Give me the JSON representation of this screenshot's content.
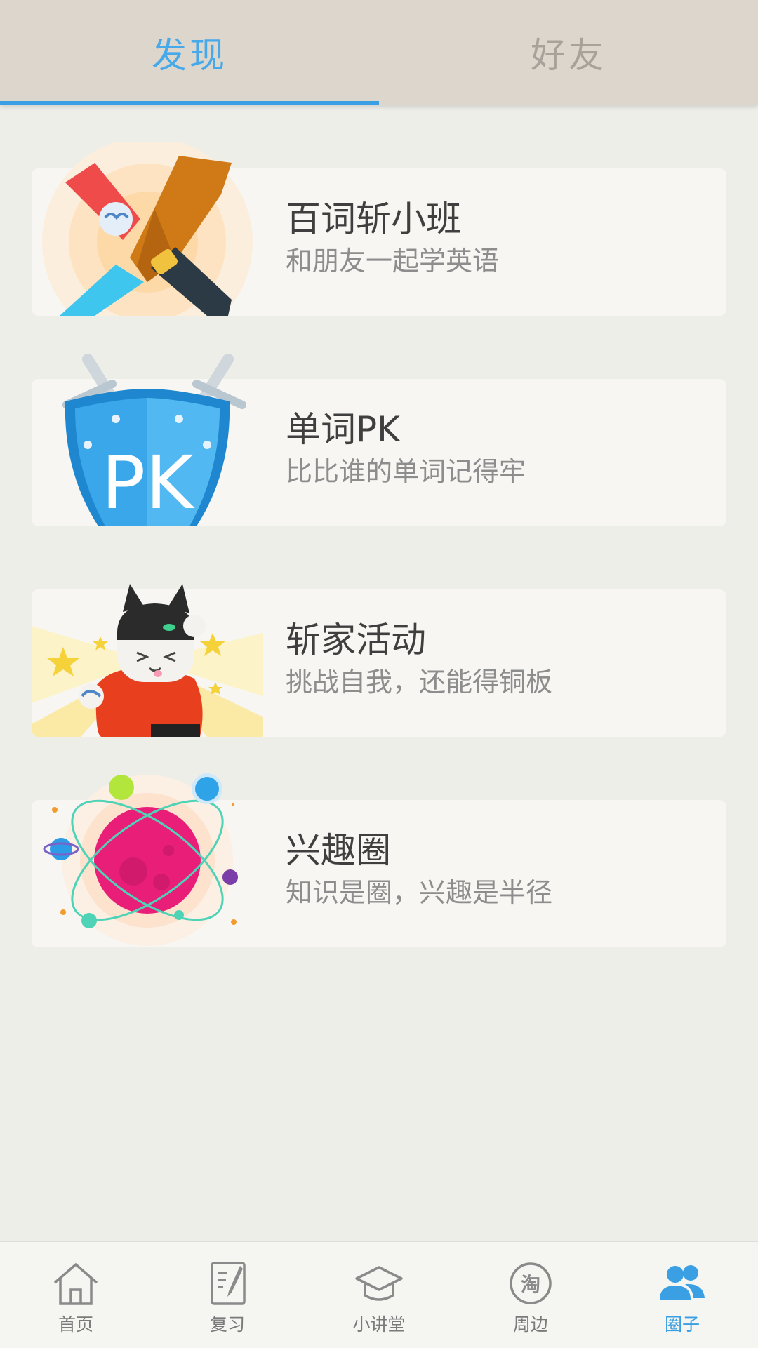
{
  "tabs": [
    {
      "label": "发现",
      "active": true
    },
    {
      "label": "好友",
      "active": false
    }
  ],
  "cards": [
    {
      "title": "百词斩小班",
      "subtitle": "和朋友一起学英语",
      "icon": "handshake-icon"
    },
    {
      "title": "单词PK",
      "subtitle": "比比谁的单词记得牢",
      "icon": "pk-shield-icon",
      "badge": "PK"
    },
    {
      "title": "斩家活动",
      "subtitle": "挑战自我，还能得铜板",
      "icon": "cheering-cat-icon"
    },
    {
      "title": "兴趣圈",
      "subtitle": "知识是圈，兴趣是半径",
      "icon": "planet-icon"
    }
  ],
  "nav": [
    {
      "label": "首页",
      "icon": "home-icon",
      "active": false
    },
    {
      "label": "复习",
      "icon": "review-notebook-icon",
      "active": false
    },
    {
      "label": "小讲堂",
      "icon": "graduation-cap-icon",
      "active": false
    },
    {
      "label": "周边",
      "icon": "taobao-shop-icon",
      "active": false,
      "glyph": "淘"
    },
    {
      "label": "圈子",
      "icon": "friends-icon",
      "active": true
    }
  ],
  "colors": {
    "accent": "#3a9fe3",
    "topbar": "#dcd6cd",
    "background": "#eeeee9",
    "card": "#f7f6f2"
  }
}
